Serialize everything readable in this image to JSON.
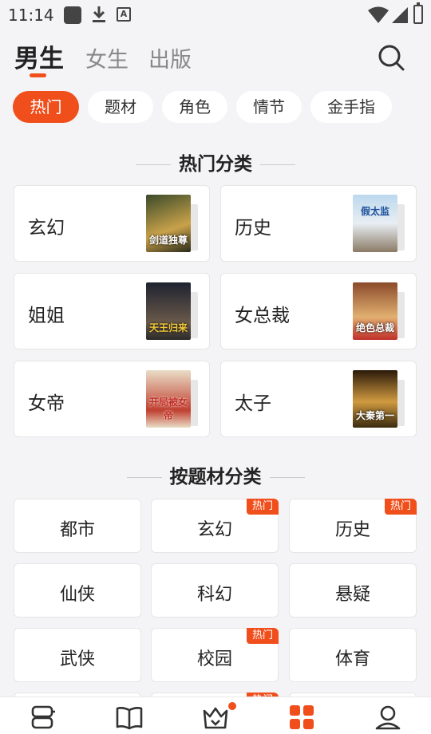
{
  "status_bar": {
    "time": "11:14",
    "icons": [
      "stop-icon",
      "download-icon",
      "font-a-icon",
      "wifi-icon",
      "signal-icon",
      "battery-icon"
    ],
    "a_glyph": "A"
  },
  "top_tabs": [
    {
      "label": "男生",
      "active": true
    },
    {
      "label": "女生",
      "active": false
    },
    {
      "label": "出版",
      "active": false
    }
  ],
  "search_icon": "search-icon",
  "chips": [
    {
      "label": "热门",
      "active": true
    },
    {
      "label": "题材",
      "active": false
    },
    {
      "label": "角色",
      "active": false
    },
    {
      "label": "情节",
      "active": false
    },
    {
      "label": "金手指",
      "active": false
    }
  ],
  "hot_categories": {
    "title": "热门分类",
    "items": [
      {
        "label": "玄幻",
        "cover_text": "剑道独尊",
        "cover_colors": [
          "#3a4a2a",
          "#c9a24a"
        ]
      },
      {
        "label": "历史",
        "cover_text": "假太监",
        "cover_colors": [
          "#bcd8ee",
          "#8a7a66"
        ]
      },
      {
        "label": "姐姐",
        "cover_text": "天王归来",
        "cover_colors": [
          "#1e2230",
          "#6a5a4a"
        ]
      },
      {
        "label": "女总裁",
        "cover_text": "绝色总裁",
        "cover_colors": [
          "#8a4a2a",
          "#e2b070"
        ]
      },
      {
        "label": "女帝",
        "cover_text": "开局被女帝",
        "cover_colors": [
          "#e9ddc6",
          "#c04030"
        ]
      },
      {
        "label": "太子",
        "cover_text": "大秦第一",
        "cover_colors": [
          "#2a1a0a",
          "#d09a40"
        ]
      }
    ]
  },
  "genre_section": {
    "title": "按题材分类",
    "hot_label": "热门",
    "items": [
      {
        "label": "都市",
        "hot": false
      },
      {
        "label": "玄幻",
        "hot": true
      },
      {
        "label": "历史",
        "hot": true
      },
      {
        "label": "仙侠",
        "hot": false
      },
      {
        "label": "科幻",
        "hot": false
      },
      {
        "label": "悬疑",
        "hot": false
      },
      {
        "label": "武侠",
        "hot": false
      },
      {
        "label": "校园",
        "hot": true
      },
      {
        "label": "体育",
        "hot": false
      }
    ]
  },
  "bottom_nav": [
    {
      "icon": "bookshelf-icon",
      "active": false
    },
    {
      "icon": "open-book-icon",
      "active": false
    },
    {
      "icon": "crown-icon",
      "active": false,
      "dot": true
    },
    {
      "icon": "category-grid-icon",
      "active": true
    },
    {
      "icon": "profile-icon",
      "active": false
    }
  ],
  "colors": {
    "accent": "#f04e1b",
    "background": "#f4f3f5",
    "card": "#ffffff",
    "inactive_tab": "#888888"
  }
}
